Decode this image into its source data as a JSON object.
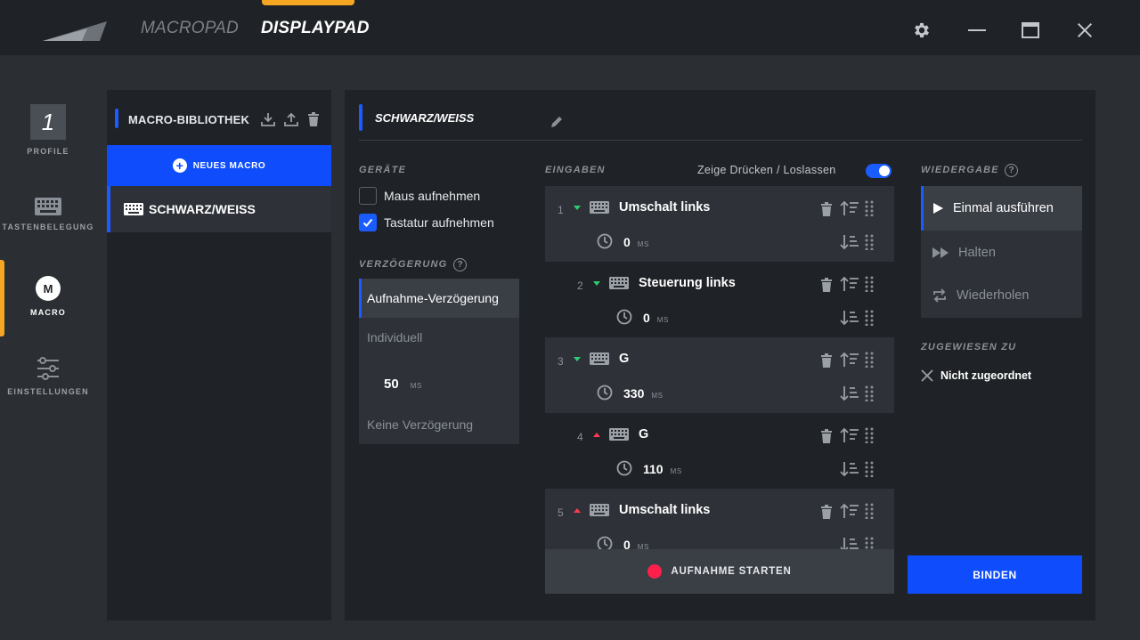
{
  "titlebar": {
    "tabs": [
      {
        "label": "MACROPAD"
      },
      {
        "label": "DISPLAYPAD"
      }
    ],
    "active_tab": "DISPLAYPAD",
    "accent": "#f5a623"
  },
  "nav": {
    "profile_number": "1",
    "items": [
      {
        "label": "PROFILE"
      },
      {
        "label": "TASTENBELEGUNG"
      },
      {
        "label": "MACRO",
        "glyph": "M"
      },
      {
        "label": "EINSTELLUNGEN"
      }
    ]
  },
  "library": {
    "title": "MACRO-BIBLIOTHEK",
    "new_macro_label": "NEUES MACRO",
    "items": [
      {
        "label": "SCHWARZ/WEISS"
      }
    ]
  },
  "editor": {
    "macro_name": "SCHWARZ/WEISS",
    "devices": {
      "title": "GERÄTE",
      "options": [
        {
          "label": "Maus aufnehmen",
          "checked": false
        },
        {
          "label": "Tastatur aufnehmen",
          "checked": true
        }
      ]
    },
    "delay": {
      "title": "VERZÖGERUNG",
      "help_glyph": "?",
      "options": [
        {
          "label": "Aufnahme-Verzögerung"
        },
        {
          "label": "Individuell"
        },
        {
          "label": "Keine Verzögerung"
        }
      ],
      "custom_value": "50",
      "unit": "MS"
    },
    "inputs": {
      "title": "EINGABEN",
      "toggle_label": "Zeige Drücken / Loslassen",
      "toggle_on": true,
      "events": [
        {
          "num": "1",
          "direction": "down",
          "key": "Umschalt links",
          "delay": "0",
          "unit": "MS"
        },
        {
          "num": "2",
          "direction": "down",
          "key": "Steuerung links",
          "delay": "0",
          "unit": "MS"
        },
        {
          "num": "3",
          "direction": "down",
          "key": "G",
          "delay": "330",
          "unit": "MS"
        },
        {
          "num": "4",
          "direction": "up",
          "key": "G",
          "delay": "110",
          "unit": "MS"
        },
        {
          "num": "5",
          "direction": "up",
          "key": "Umschalt links",
          "delay": "0",
          "unit": "MS"
        }
      ],
      "record_label": "AUFNAHME STARTEN",
      "record_color": "#ff1f4b"
    },
    "playback": {
      "title": "WIEDERGABE",
      "help_glyph": "?",
      "options": [
        {
          "label": "Einmal ausführen",
          "icon": "play-icon"
        },
        {
          "label": "Halten",
          "icon": "fast-forward-icon"
        },
        {
          "label": "Wiederholen",
          "icon": "repeat-icon"
        }
      ]
    },
    "assigned": {
      "title": "ZUGEWIESEN ZU",
      "value": "Nicht zugeordnet"
    },
    "bind_label": "BINDEN",
    "brand_blue": "#0f4dfc"
  }
}
